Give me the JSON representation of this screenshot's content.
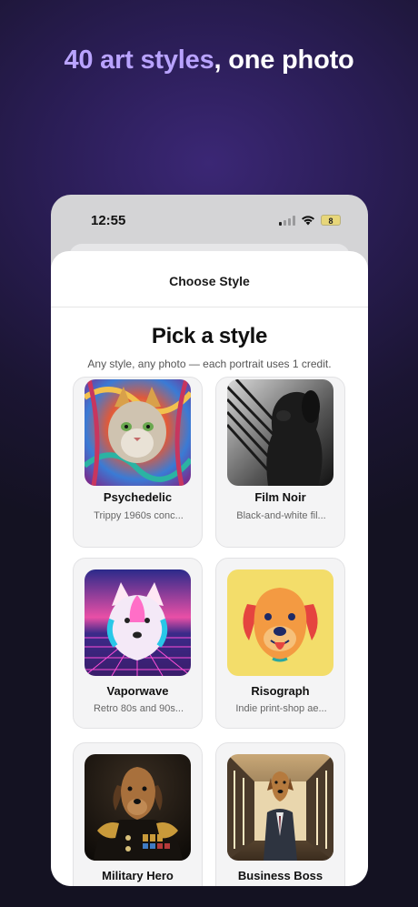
{
  "headline": {
    "accent": "40 art styles",
    "rest": ", one photo"
  },
  "status_bar": {
    "time": "12:55",
    "battery": "8"
  },
  "sheet": {
    "nav_title": "Choose Style",
    "title": "Pick a style",
    "subtitle": "Any style, any photo — each portrait uses 1 credit."
  },
  "styles": [
    {
      "name": "Psychedelic",
      "description": "Trippy 1960s conc...",
      "icon": "psychedelic-cat-thumbnail"
    },
    {
      "name": "Film Noir",
      "description": "Black-and-white fil...",
      "icon": "film-noir-dog-thumbnail"
    },
    {
      "name": "Vaporwave",
      "description": "Retro 80s and 90s...",
      "icon": "vaporwave-dog-thumbnail"
    },
    {
      "name": "Risograph",
      "description": "Indie print-shop ae...",
      "icon": "risograph-dog-thumbnail"
    },
    {
      "name": "Military Hero",
      "description": "",
      "icon": "military-dog-thumbnail"
    },
    {
      "name": "Business Boss",
      "description": "",
      "icon": "business-dog-thumbnail"
    }
  ],
  "colors": {
    "accent": "#b9a3ff",
    "background": "#2a1d55",
    "card": "#f4f4f5"
  }
}
